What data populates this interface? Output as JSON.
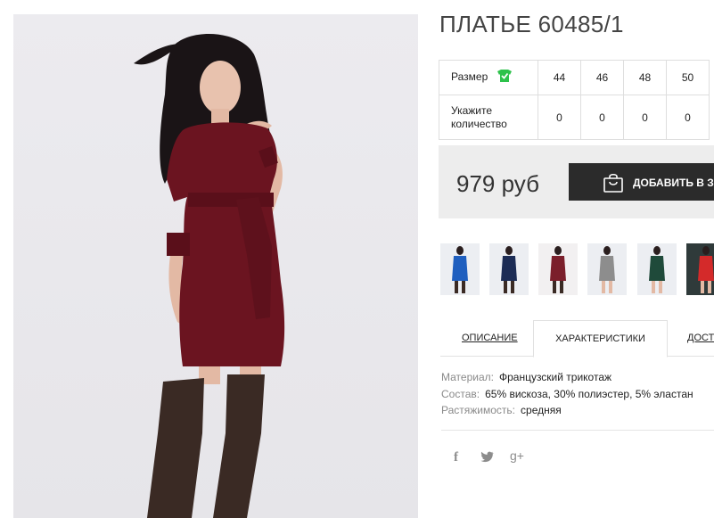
{
  "product": {
    "title": "ПЛАТЬЕ 60485/1"
  },
  "sizes": {
    "size_label": "Размер",
    "qty_label": "Укажите количество",
    "columns": [
      "44",
      "46",
      "48",
      "50"
    ],
    "quantities": [
      "0",
      "0",
      "0",
      "0"
    ]
  },
  "purchase": {
    "price": "979 руб",
    "add_to_cart_label": "ДОБАВИТЬ В ЗАКАЗ"
  },
  "thumbnails": [
    {
      "color": "#1f5fbf"
    },
    {
      "color": "#1c2c55"
    },
    {
      "color": "#7b1f2b"
    },
    {
      "color": "#8d8d8d"
    },
    {
      "color": "#1f4a3a"
    },
    {
      "color": "#d42a2a"
    }
  ],
  "tabs": [
    {
      "label": "ОПИСАНИЕ",
      "active": false
    },
    {
      "label": "ХАРАКТЕРИСТИКИ",
      "active": true
    },
    {
      "label": "ДОСТАВКА",
      "active": false
    }
  ],
  "specs": [
    {
      "key": "Материал:",
      "value": "Французский трикотаж"
    },
    {
      "key": "Состав:",
      "value": "65% вискоза, 30% полиэстер, 5% эластан"
    },
    {
      "key": "Растяжимость:",
      "value": "средняя"
    }
  ],
  "social": {
    "facebook": "f",
    "twitter": "twitter-icon",
    "googleplus": "g+"
  },
  "colors": {
    "dress": "#6b1420",
    "boots": "#3a2a24",
    "button": "#2b2b2b",
    "size_icon": "#2ec24b"
  }
}
